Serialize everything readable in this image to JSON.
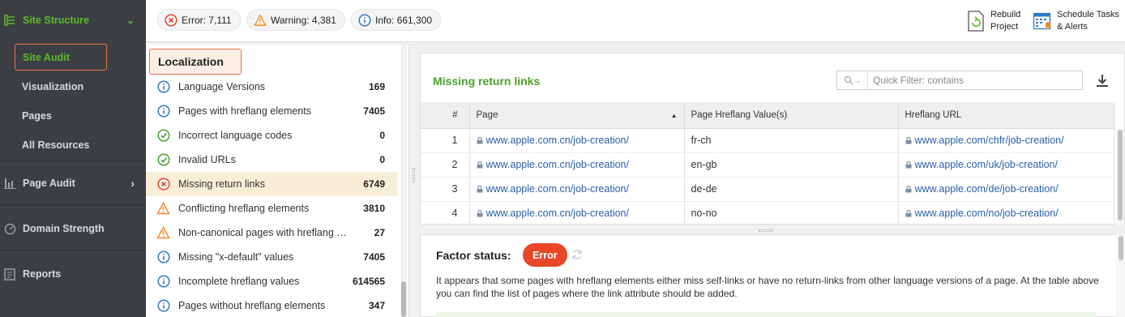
{
  "nav": {
    "site_structure": "Site Structure",
    "sub_items": [
      "Site Audit",
      "Visualization",
      "Pages",
      "All Resources"
    ],
    "page_audit": "Page Audit",
    "domain_strength": "Domain Strength",
    "reports": "Reports",
    "active_color": "#5cb82a"
  },
  "topbar": {
    "error": "Error: 7,111",
    "warning": "Warning: 4,381",
    "info": "Info: 661,300",
    "rebuild": [
      "Rebuild",
      "Project"
    ],
    "schedule": [
      "Schedule Tasks",
      "& Alerts"
    ]
  },
  "localization": {
    "title": "Localization",
    "items": [
      {
        "label": "Language Versions",
        "count": "169",
        "status": "info"
      },
      {
        "label": "Pages with hreflang elements",
        "count": "7405",
        "status": "info"
      },
      {
        "label": "Incorrect language codes",
        "count": "0",
        "status": "ok"
      },
      {
        "label": "Invalid URLs",
        "count": "0",
        "status": "ok"
      },
      {
        "label": "Missing return links",
        "count": "6749",
        "status": "error"
      },
      {
        "label": "Conflicting hreflang elements",
        "count": "3810",
        "status": "warning"
      },
      {
        "label": "Non-canonical pages with hreflang eleme...",
        "count": "27",
        "status": "warning"
      },
      {
        "label": "Missing \"x-default\" values",
        "count": "7405",
        "status": "info"
      },
      {
        "label": "Incomplete hreflang values",
        "count": "614565",
        "status": "info"
      },
      {
        "label": "Pages without hreflang elements",
        "count": "347",
        "status": "info"
      }
    ]
  },
  "table": {
    "title": "Missing return links",
    "filter_placeholder": "Quick Filter: contains",
    "columns": [
      "#",
      "Page",
      "Page Hreflang Value(s)",
      "Hreflang URL"
    ],
    "rows": [
      {
        "n": "1",
        "page": "www.apple.com.cn/job-creation/",
        "value": "fr-ch",
        "url": "www.apple.com/chfr/job-creation/"
      },
      {
        "n": "2",
        "page": "www.apple.com.cn/job-creation/",
        "value": "en-gb",
        "url": "www.apple.com/uk/job-creation/"
      },
      {
        "n": "3",
        "page": "www.apple.com.cn/job-creation/",
        "value": "de-de",
        "url": "www.apple.com/de/job-creation/"
      },
      {
        "n": "4",
        "page": "www.apple.com.cn/job-creation/",
        "value": "no-no",
        "url": "www.apple.com/no/job-creation/"
      }
    ]
  },
  "factor": {
    "label": "Factor status:",
    "status": "Error",
    "description": "It appears that some pages with hreflang elements either miss self-links or have no return-links from other language versions of a page. At the table above you can find the list of pages where the link attribute should be added."
  }
}
